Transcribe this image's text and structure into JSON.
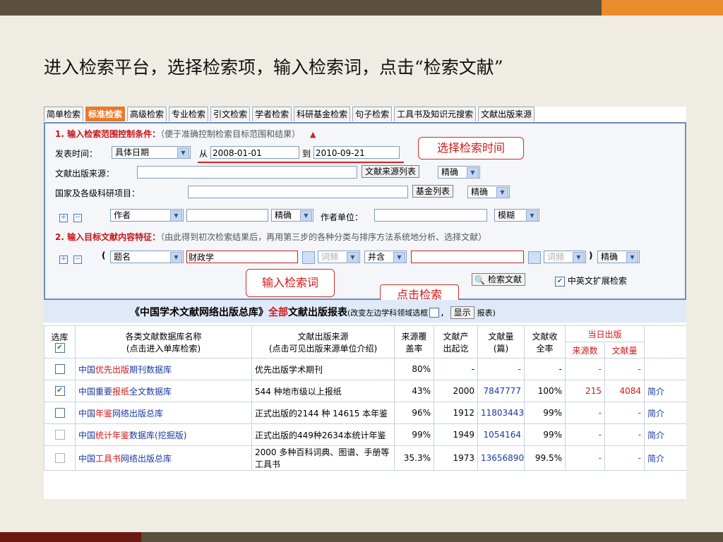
{
  "slide": {
    "title": "进入检索平台，选择检索项，输入检索词，点击“检索文献”"
  },
  "tabs": [
    "简单检索",
    "标准检索",
    "高级检索",
    "专业检索",
    "引文检索",
    "学者检索",
    "科研基金检索",
    "句子检索",
    "工具书及知识元搜索",
    "文献出版来源"
  ],
  "section1": {
    "title": "1. 输入检索范围控制条件：",
    "hint": "（便于准确控制检索目标范围和结果）"
  },
  "date": {
    "label": "发表时间：",
    "mode": "具体日期",
    "from_label": "从",
    "from": "2008-01-01",
    "to_label": "到",
    "to": "2010-09-21"
  },
  "source": {
    "label": "文献出版来源：",
    "value": "",
    "list_button": "文献来源列表",
    "match": "精确"
  },
  "fund": {
    "label": "国家及各级科研项目：",
    "value": "",
    "list_button": "基金列表",
    "match": "精确"
  },
  "author": {
    "plus": "+",
    "minus": "−",
    "field": "作者",
    "value": "",
    "match": "精确",
    "org_label": "作者单位：",
    "org_value": "",
    "org_match": "模糊"
  },
  "section2": {
    "title": "2. 输入目标文献内容特征：",
    "hint": "（由此得到初次检索结果后，再用第三步的各种分类与排序方法系统地分析、选择文献）"
  },
  "query": {
    "open_paren": "(",
    "field": "题名",
    "value": "财政学",
    "freq": "词频",
    "logic": "并含",
    "value2": "",
    "freq2": "词频",
    "close_paren": ")",
    "match": "精确"
  },
  "search": {
    "button": "检索文献",
    "expand_label": "中英文扩展检索"
  },
  "callouts": {
    "time": "选择检索时间",
    "term": "输入检索词",
    "click": "点击检索"
  },
  "summary": {
    "part1": "《中国学术文献网络出版总库》",
    "all": "全部",
    "part2": "文献出版报表",
    "note": "(改变左边学科领域选框",
    "comma": ",",
    "show": "显示",
    "end": "报表)"
  },
  "table": {
    "headers": {
      "select": "选库",
      "name1": "各类文献数据库名称",
      "name2": "(点击进入单库检索)",
      "source1": "文献出版来源",
      "source2": "(点击可见出版来源单位介绍)",
      "coverage1": "来源覆",
      "coverage2": "盖率",
      "since1": "文献产",
      "since2": "出起讫",
      "count1": "文献量",
      "count2": "(篇)",
      "full1": "文献收",
      "full2": "全率",
      "today": "当日出版",
      "today_src": "来源数",
      "today_cnt": "文献量"
    },
    "rows": [
      {
        "checked": "",
        "pre": "中国",
        "hl": "优先出版",
        "post": "期刊数据库",
        "source": "优先出版学术期刊",
        "coverage": "80%",
        "since": "-",
        "count": "-",
        "full": "-",
        "tsrc": "-",
        "tcnt": "-",
        "intro": ""
      },
      {
        "checked": "✔",
        "pre": "中国重要",
        "hl": "报纸",
        "post": "全文数据库",
        "source": "544 种地市级以上报纸",
        "coverage": "43%",
        "since": "2000",
        "count": "7847777",
        "full": "100%",
        "tsrc": "215",
        "tcnt": "4084",
        "intro": "简介"
      },
      {
        "checked": "",
        "pre": "中国",
        "hl": "年鉴",
        "post": "网络出版总库",
        "source": "正式出版的2144 种  14615 本年鉴",
        "coverage": "96%",
        "since": "1912",
        "count": "11803443",
        "full": "99%",
        "tsrc": "-",
        "tcnt": "-",
        "intro": "简介"
      },
      {
        "checked": "",
        "pre": "中国",
        "hl": "统计年鉴",
        "post": "数据库(挖掘版)",
        "source": "正式出版的449种2634本统计年鉴",
        "coverage": "99%",
        "since": "1949",
        "count": "1054164",
        "full": "99%",
        "tsrc": "-",
        "tcnt": "-",
        "intro": "简介"
      },
      {
        "checked": "",
        "pre": "中国",
        "hl": "工具书",
        "post": "网络出版总库",
        "source": "2000 多种百科词典、图谱、手册等工具书",
        "coverage": "35.3%",
        "since": "1973",
        "count": "13656890",
        "full": "99.5%",
        "tsrc": "-",
        "tcnt": "-",
        "intro": "简介"
      }
    ]
  }
}
